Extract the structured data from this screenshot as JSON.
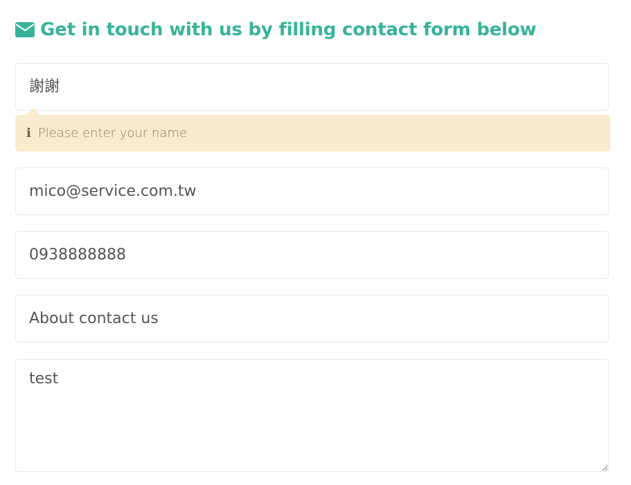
{
  "header": {
    "icon": "envelope-icon",
    "title": "Get in touch with us by filling contact form below",
    "color": "#37b39a"
  },
  "form": {
    "name_value": "謝謝",
    "name_error": "Please enter your name",
    "email_value": "mico@service.com.tw",
    "phone_value": "0938888888",
    "subject_value": "About contact us",
    "message_value": "test"
  }
}
